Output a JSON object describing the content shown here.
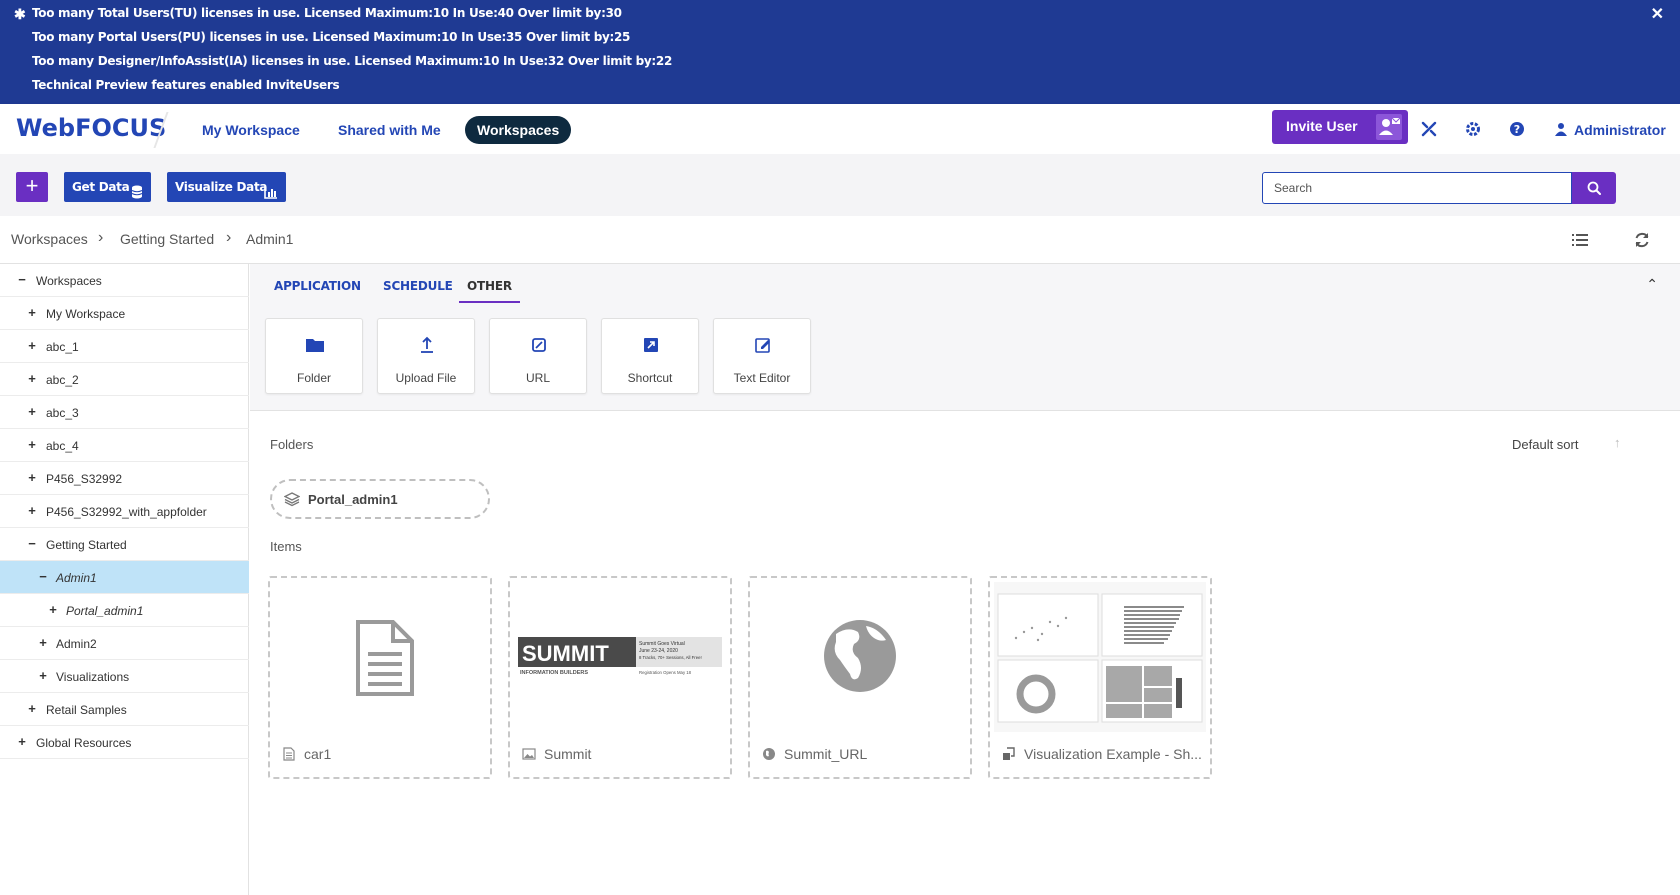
{
  "banner": {
    "lines": [
      "Too many Total Users(TU) licenses in use. Licensed Maximum:10 In Use:40 Over limit by:30",
      "Too many Portal Users(PU) licenses in use. Licensed Maximum:10 In Use:35 Over limit by:25",
      "Too many Designer/InfoAssist(IA) licenses in use. Licensed Maximum:10 In Use:32 Over limit by:22",
      "Technical Preview features enabled InviteUsers"
    ],
    "close_label": "✕",
    "background": "#1f3a93"
  },
  "header": {
    "logo": "WebFOCUS",
    "nav": [
      "My Workspace",
      "Shared with Me",
      "Workspaces"
    ],
    "active_nav": "Workspaces",
    "invite_label": "Invite User",
    "user_label": "Administrator",
    "icons": [
      "tools-icon",
      "gear-icon",
      "help-icon",
      "user-icon"
    ]
  },
  "toolbar": {
    "plus_label": "+",
    "get_data_label": "Get Data",
    "visualize_label": "Visualize Data",
    "search_placeholder": "Search"
  },
  "breadcrumb": {
    "items": [
      "Workspaces",
      "Getting Started",
      "Admin1"
    ]
  },
  "sidebar": {
    "items": [
      {
        "label": "Workspaces",
        "toggle": "−"
      },
      {
        "label": "My Workspace",
        "toggle": "+"
      },
      {
        "label": "abc_1",
        "toggle": "+"
      },
      {
        "label": "abc_2",
        "toggle": "+"
      },
      {
        "label": "abc_3",
        "toggle": "+"
      },
      {
        "label": "abc_4",
        "toggle": "+"
      },
      {
        "label": "P456_S32992",
        "toggle": "+"
      },
      {
        "label": "P456_S32992_with_appfolder",
        "toggle": "+"
      },
      {
        "label": "Getting Started",
        "toggle": "−"
      },
      {
        "label": "Admin1",
        "toggle": "−"
      },
      {
        "label": "Portal_admin1",
        "toggle": "+"
      },
      {
        "label": "Admin2",
        "toggle": "+"
      },
      {
        "label": "Visualizations",
        "toggle": "+"
      },
      {
        "label": "Retail Samples",
        "toggle": "+"
      },
      {
        "label": "Global Resources",
        "toggle": "+"
      }
    ],
    "collapse_label": "‹"
  },
  "create_panel": {
    "tabs": [
      "APPLICATION",
      "SCHEDULE",
      "OTHER"
    ],
    "active_tab": "OTHER",
    "tiles": [
      "Folder",
      "Upload File",
      "URL",
      "Shortcut",
      "Text Editor"
    ],
    "collapse_label": "⌃"
  },
  "content": {
    "folders_title": "Folders",
    "sort_label": "Default sort",
    "sort_arrow": "↑",
    "folders": [
      "Portal_admin1"
    ],
    "items_title": "Items",
    "items": [
      {
        "title": "car1",
        "type": "document"
      },
      {
        "title": "Summit",
        "type": "image"
      },
      {
        "title": "Summit_URL",
        "type": "url"
      },
      {
        "title": "Visualization Example - Sh...",
        "type": "visualization"
      }
    ],
    "summit_thumb": {
      "brand": "SUMMIT",
      "sub_brand": "INFORMATION BUILDERS",
      "line1": "Summit Goes Virtual",
      "line2": "June 23-24, 2020",
      "line3": "8 Tracks, 70+ Sessions, All Free!",
      "line4": "Registration Opens May 18"
    }
  },
  "colors": {
    "accent_blue": "#2346b5",
    "accent_purple": "#6a2fc2",
    "selected_row": "#bfe3f8",
    "nav_active": "#0e2a3f"
  }
}
